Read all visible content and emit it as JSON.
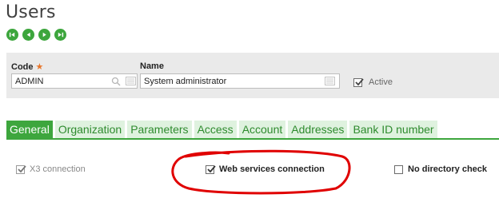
{
  "page": {
    "title": "Users"
  },
  "nav": {
    "buttons": [
      {
        "icon": "first-record-icon"
      },
      {
        "icon": "previous-record-icon"
      },
      {
        "icon": "next-record-icon"
      },
      {
        "icon": "last-record-icon"
      }
    ]
  },
  "header": {
    "code_label": "Code",
    "required_marker": "★",
    "code_value": "ADMIN",
    "name_label": "Name",
    "name_value": "System administrator",
    "active_label": "Active",
    "active_checked": true
  },
  "tabs": [
    {
      "label": "General",
      "active": true
    },
    {
      "label": "Organization",
      "active": false
    },
    {
      "label": "Parameters",
      "active": false
    },
    {
      "label": "Access",
      "active": false
    },
    {
      "label": "Account",
      "active": false
    },
    {
      "label": "Addresses",
      "active": false
    },
    {
      "label": "Bank ID number",
      "active": false
    }
  ],
  "general": {
    "x3_connection_label": "X3 connection",
    "x3_connection_checked": true,
    "web_services_label": "Web services connection",
    "web_services_checked": true,
    "no_directory_label": "No directory check",
    "no_directory_checked": false
  },
  "colors": {
    "accent": "#3da63d",
    "tab_bg": "#dff2df",
    "annotation": "#e00000"
  }
}
